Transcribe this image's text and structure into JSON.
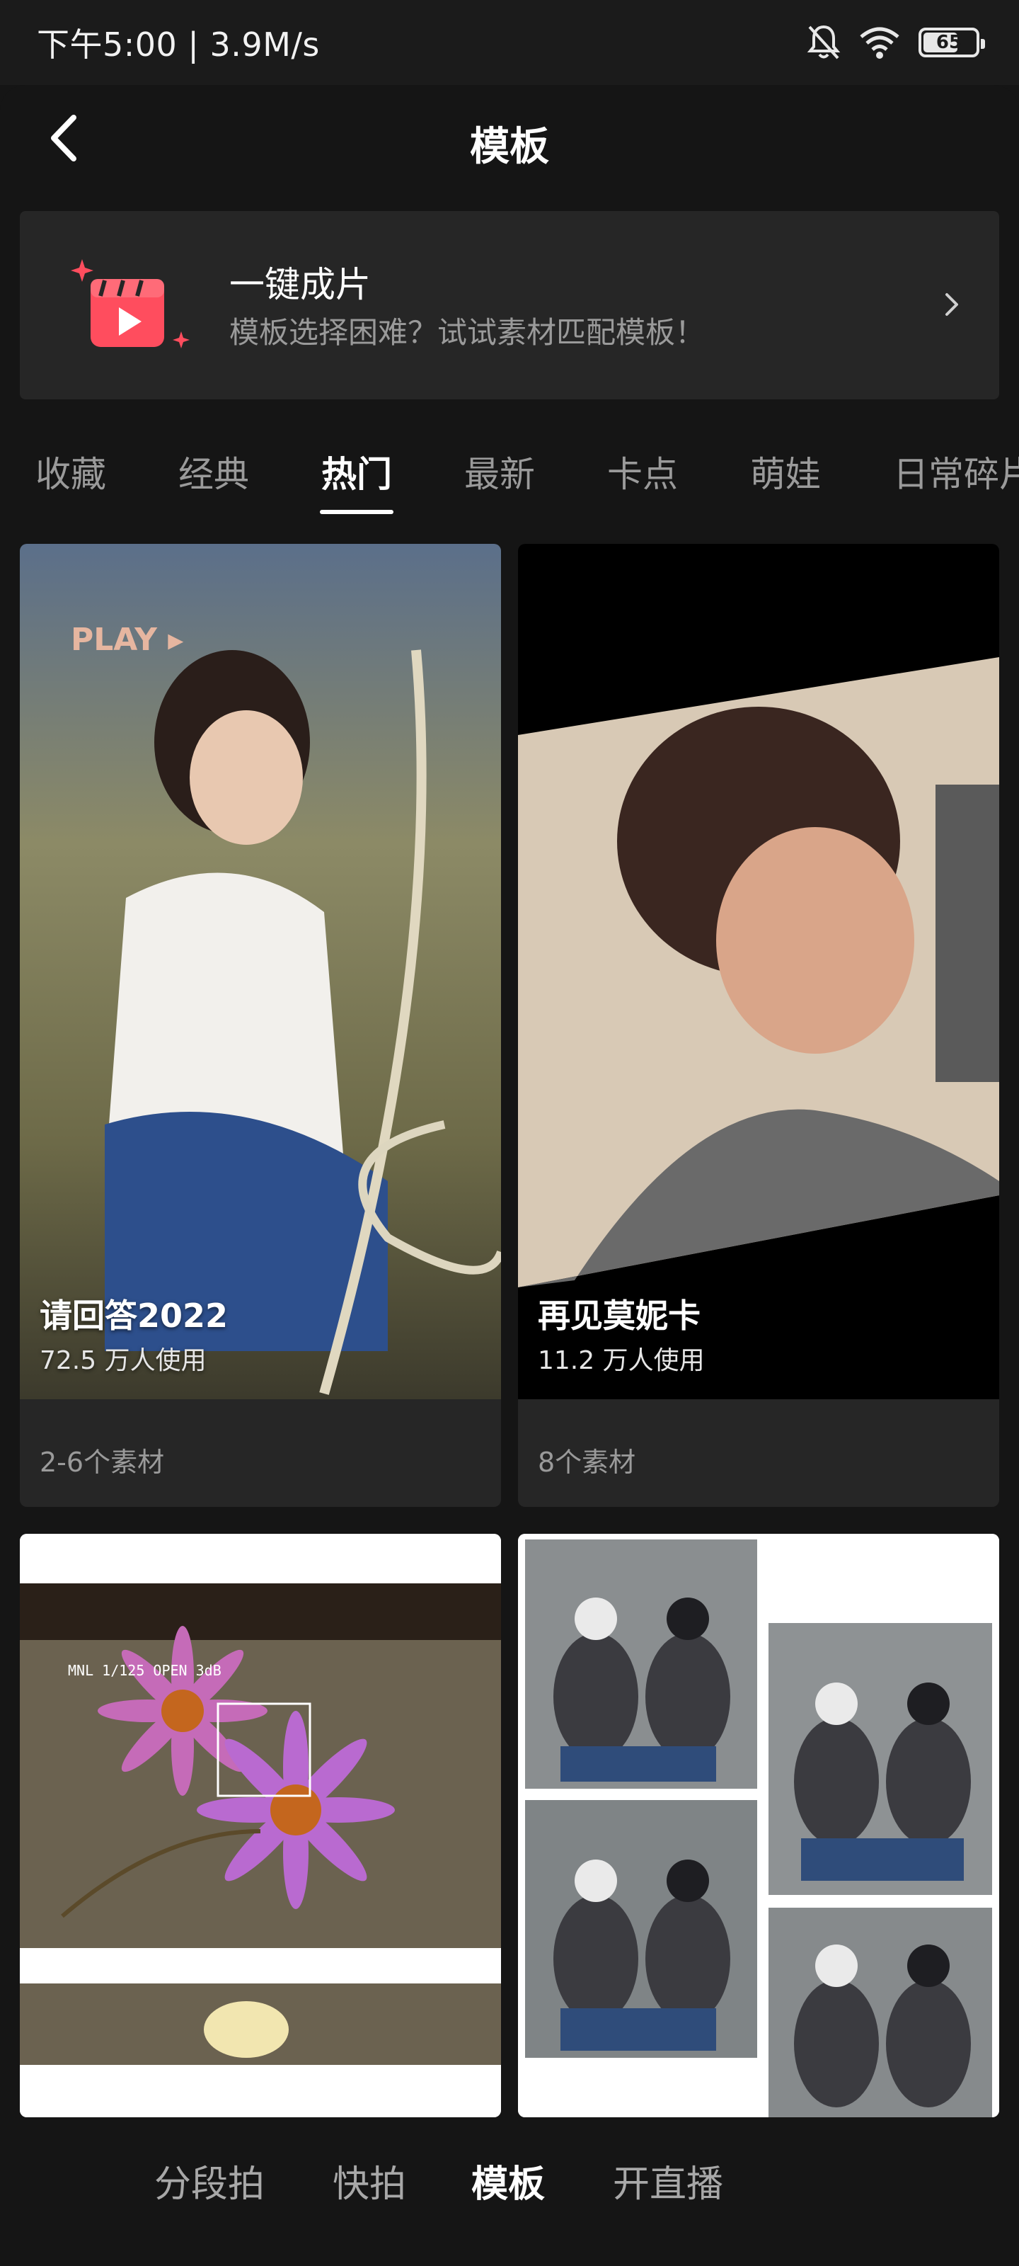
{
  "status_bar": {
    "time_speed": "下午5:00 | 3.9M/s",
    "battery_level": "65",
    "icons": [
      "bell-off-icon",
      "wifi-icon",
      "battery-icon"
    ]
  },
  "header": {
    "title": "模板",
    "back_icon": "chevron-left-icon"
  },
  "banner": {
    "title": "一键成片",
    "subtitle": "模板选择困难？试试素材匹配模板！",
    "icon": "clapperboard-icon",
    "chevron_icon": "chevron-right-icon",
    "accent_color": "#ff4d5e"
  },
  "tabs": [
    {
      "label": "收藏"
    },
    {
      "label": "经典"
    },
    {
      "label": "热门",
      "active": true
    },
    {
      "label": "最新"
    },
    {
      "label": "卡点"
    },
    {
      "label": "萌娃"
    },
    {
      "label": "日常碎片"
    }
  ],
  "templates": [
    {
      "title": "请回答2022",
      "uses": "72.5 万人使用",
      "materials": "2-6个素材",
      "thumb_label": "PLAY ▸"
    },
    {
      "title": "再见莫妮卡",
      "uses": "11.2 万人使用",
      "materials": "8个素材"
    },
    {
      "thumb_label": "MNL 1/125 OPEN 3dB"
    },
    {}
  ],
  "bottom_nav": [
    {
      "label": "分段拍"
    },
    {
      "label": "快拍"
    },
    {
      "label": "模板",
      "active": true
    },
    {
      "label": "开直播"
    }
  ]
}
